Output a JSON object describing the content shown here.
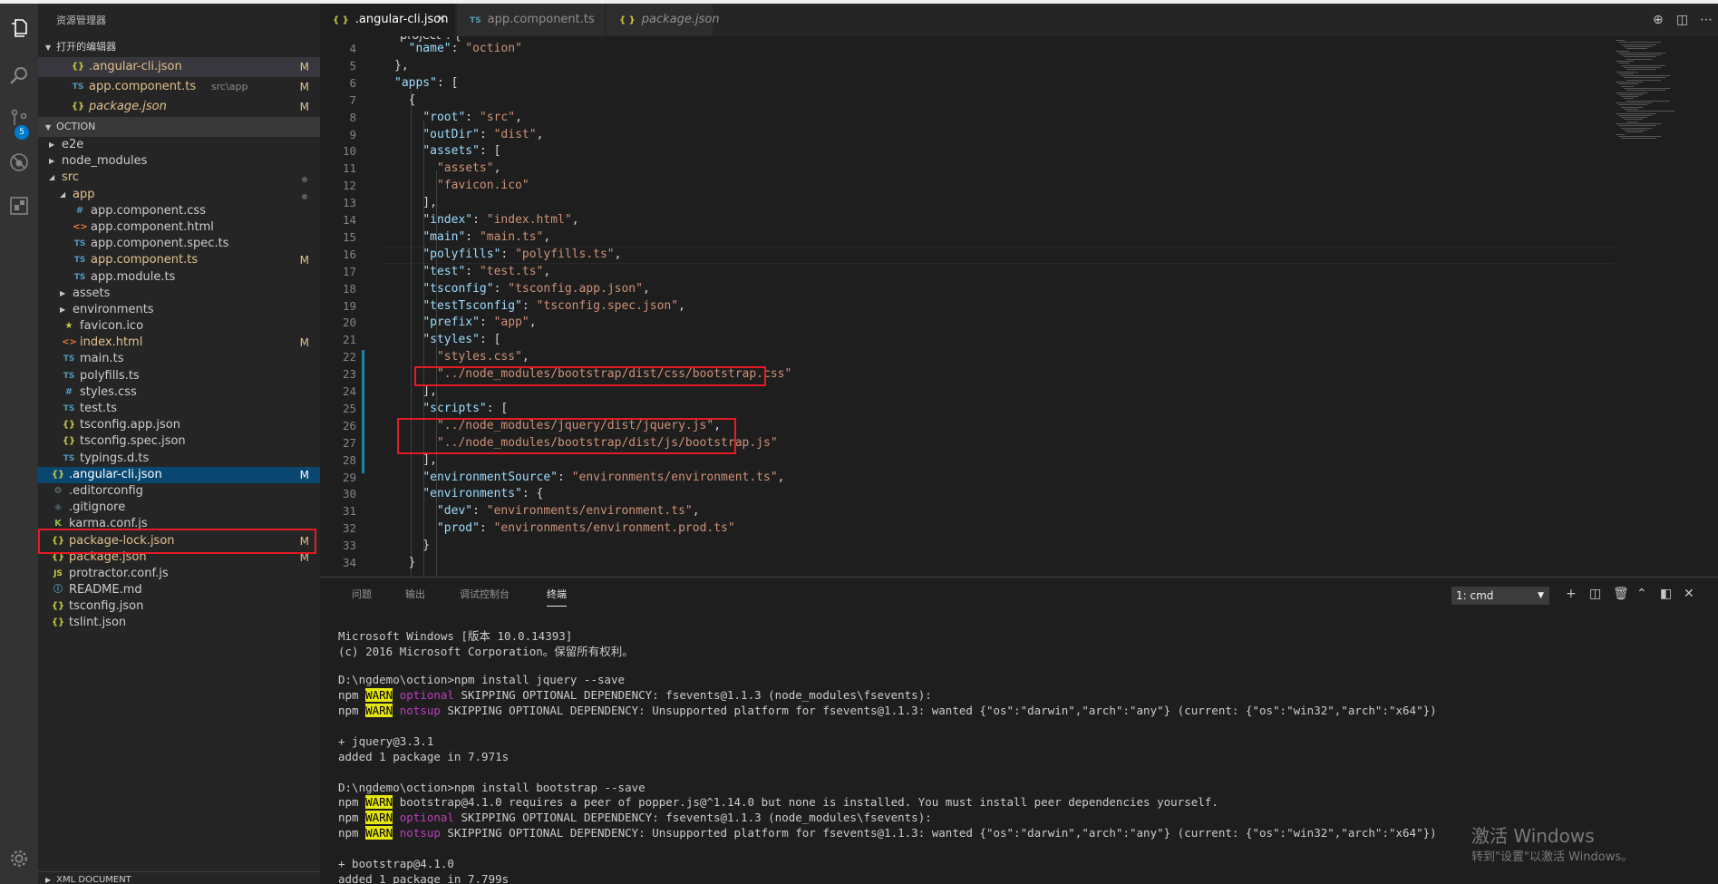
{
  "activity": {
    "scm_badge": "5"
  },
  "sidebar": {
    "title": "资源管理器",
    "open_editors_title": "打开的编辑器",
    "open_editors": [
      {
        "name": ".angular-cli.json",
        "desc": "",
        "mark": "M",
        "icon": "json"
      },
      {
        "name": "app.component.ts",
        "desc": "src\\app",
        "mark": "M",
        "icon": "ts"
      },
      {
        "name": "package.json",
        "desc": "",
        "mark": "M",
        "icon": "json"
      }
    ],
    "project_title": "OCTION",
    "tree": [
      {
        "name": "e2e"
      },
      {
        "name": "node_modules"
      },
      {
        "name": "src"
      },
      {
        "name": "app"
      },
      {
        "name": "app.component.css"
      },
      {
        "name": "app.component.html"
      },
      {
        "name": "app.component.spec.ts"
      },
      {
        "name": "app.component.ts",
        "mark": "M"
      },
      {
        "name": "app.module.ts"
      },
      {
        "name": "assets"
      },
      {
        "name": "environments"
      },
      {
        "name": "favicon.ico"
      },
      {
        "name": "index.html",
        "mark": "M"
      },
      {
        "name": "main.ts"
      },
      {
        "name": "polyfills.ts"
      },
      {
        "name": "styles.css"
      },
      {
        "name": "test.ts"
      },
      {
        "name": "tsconfig.app.json"
      },
      {
        "name": "tsconfig.spec.json"
      },
      {
        "name": "typings.d.ts"
      },
      {
        "name": ".angular-cli.json",
        "mark": "M"
      },
      {
        "name": ".editorconfig"
      },
      {
        "name": ".gitignore"
      },
      {
        "name": "karma.conf.js"
      },
      {
        "name": "package-lock.json",
        "mark": "M"
      },
      {
        "name": "package.json",
        "mark": "M"
      },
      {
        "name": "protractor.conf.js"
      },
      {
        "name": "README.md"
      },
      {
        "name": "tsconfig.json"
      },
      {
        "name": "tslint.json"
      }
    ],
    "outline_title": "XML DOCUMENT"
  },
  "tabs": [
    {
      "label": ".angular-cli.json",
      "active": true,
      "icon": "{ }"
    },
    {
      "label": "app.component.ts",
      "active": false,
      "icon": "TS"
    },
    {
      "label": "package.json",
      "active": false,
      "icon": "{ }"
    }
  ],
  "editor": {
    "line_numbers": [
      "4",
      "5",
      "6",
      "7",
      "8",
      "9",
      "10",
      "11",
      "12",
      "13",
      "14",
      "15",
      "16",
      "17",
      "18",
      "19",
      "20",
      "21",
      "22",
      "23",
      "24",
      "25",
      "26",
      "27",
      "28",
      "29",
      "30",
      "31",
      "32",
      "33",
      "34"
    ],
    "lines": [
      "  \"name\": \"oction\"",
      "},",
      "\"apps\": [",
      "  {",
      "    \"root\": \"src\",",
      "    \"outDir\": \"dist\",",
      "    \"assets\": [",
      "      \"assets\",",
      "      \"favicon.ico\"",
      "    ],",
      "    \"index\": \"index.html\",",
      "    \"main\": \"main.ts\",",
      "    \"polyfills\": \"polyfills.ts\",",
      "    \"test\": \"test.ts\",",
      "    \"tsconfig\": \"tsconfig.app.json\",",
      "    \"testTsconfig\": \"tsconfig.spec.json\",",
      "    \"prefix\": \"app\",",
      "    \"styles\": [",
      "      \"styles.css\",",
      "      \"../node_modules/bootstrap/dist/css/bootstrap.css\"",
      "    ],",
      "    \"scripts\": [",
      "      \"../node_modules/jquery/dist/jquery.js\",",
      "      \"../node_modules/bootstrap/dist/js/bootstrap.js\"",
      "    ],",
      "    \"environmentSource\": \"environments/environment.ts\",",
      "    \"environments\": {",
      "      \"dev\": \"environments/environment.ts\",",
      "      \"prod\": \"environments/environment.prod.ts\"",
      "    }",
      "  }"
    ]
  },
  "panel": {
    "tabs": [
      "问题",
      "输出",
      "调试控制台",
      "终端"
    ],
    "terminal_select": "1: cmd",
    "terminal": [
      [
        {
          "t": "Microsoft Windows [版本 10.0.14393]"
        }
      ],
      [
        {
          "t": "(c) 2016 Microsoft Corporation。保留所有权利。"
        }
      ],
      [
        {
          "t": ""
        }
      ],
      [
        {
          "t": "D:\\ngdemo\\oction>npm install jquery --save"
        }
      ],
      [
        {
          "t": "npm "
        },
        {
          "t": "WARN",
          "c": "warn"
        },
        {
          "t": " "
        },
        {
          "t": "optional",
          "c": "opt"
        },
        {
          "t": " SKIPPING OPTIONAL DEPENDENCY: fsevents@1.1.3 (node_modules\\fsevents):"
        }
      ],
      [
        {
          "t": "npm "
        },
        {
          "t": "WARN",
          "c": "warn"
        },
        {
          "t": " "
        },
        {
          "t": "notsup",
          "c": "opt"
        },
        {
          "t": " SKIPPING OPTIONAL DEPENDENCY: Unsupported platform for fsevents@1.1.3: wanted {\"os\":\"darwin\",\"arch\":\"any\"} (current: {\"os\":\"win32\",\"arch\":\"x64\"})"
        }
      ],
      [
        {
          "t": ""
        }
      ],
      [
        {
          "t": "+ jquery@3.3.1"
        }
      ],
      [
        {
          "t": "added 1 package in 7.971s"
        }
      ],
      [
        {
          "t": ""
        }
      ],
      [
        {
          "t": "D:\\ngdemo\\oction>npm install bootstrap --save"
        }
      ],
      [
        {
          "t": "npm "
        },
        {
          "t": "WARN",
          "c": "warn"
        },
        {
          "t": " bootstrap@4.1.0 requires a peer of popper.js@^1.14.0 but none is installed. You must install peer dependencies yourself."
        }
      ],
      [
        {
          "t": "npm "
        },
        {
          "t": "WARN",
          "c": "warn"
        },
        {
          "t": " "
        },
        {
          "t": "optional",
          "c": "opt"
        },
        {
          "t": " SKIPPING OPTIONAL DEPENDENCY: fsevents@1.1.3 (node_modules\\fsevents):"
        }
      ],
      [
        {
          "t": "npm "
        },
        {
          "t": "WARN",
          "c": "warn"
        },
        {
          "t": " "
        },
        {
          "t": "notsup",
          "c": "opt"
        },
        {
          "t": " SKIPPING OPTIONAL DEPENDENCY: Unsupported platform for fsevents@1.1.3: wanted {\"os\":\"darwin\",\"arch\":\"any\"} (current: {\"os\":\"win32\",\"arch\":\"x64\"})"
        }
      ],
      [
        {
          "t": ""
        }
      ],
      [
        {
          "t": "+ bootstrap@4.1.0"
        }
      ],
      [
        {
          "t": "added 1 package in 7.799s"
        }
      ]
    ]
  },
  "watermark": {
    "line1": "激活 Windows",
    "line2": "转到\"设置\"以激活 Windows。"
  }
}
